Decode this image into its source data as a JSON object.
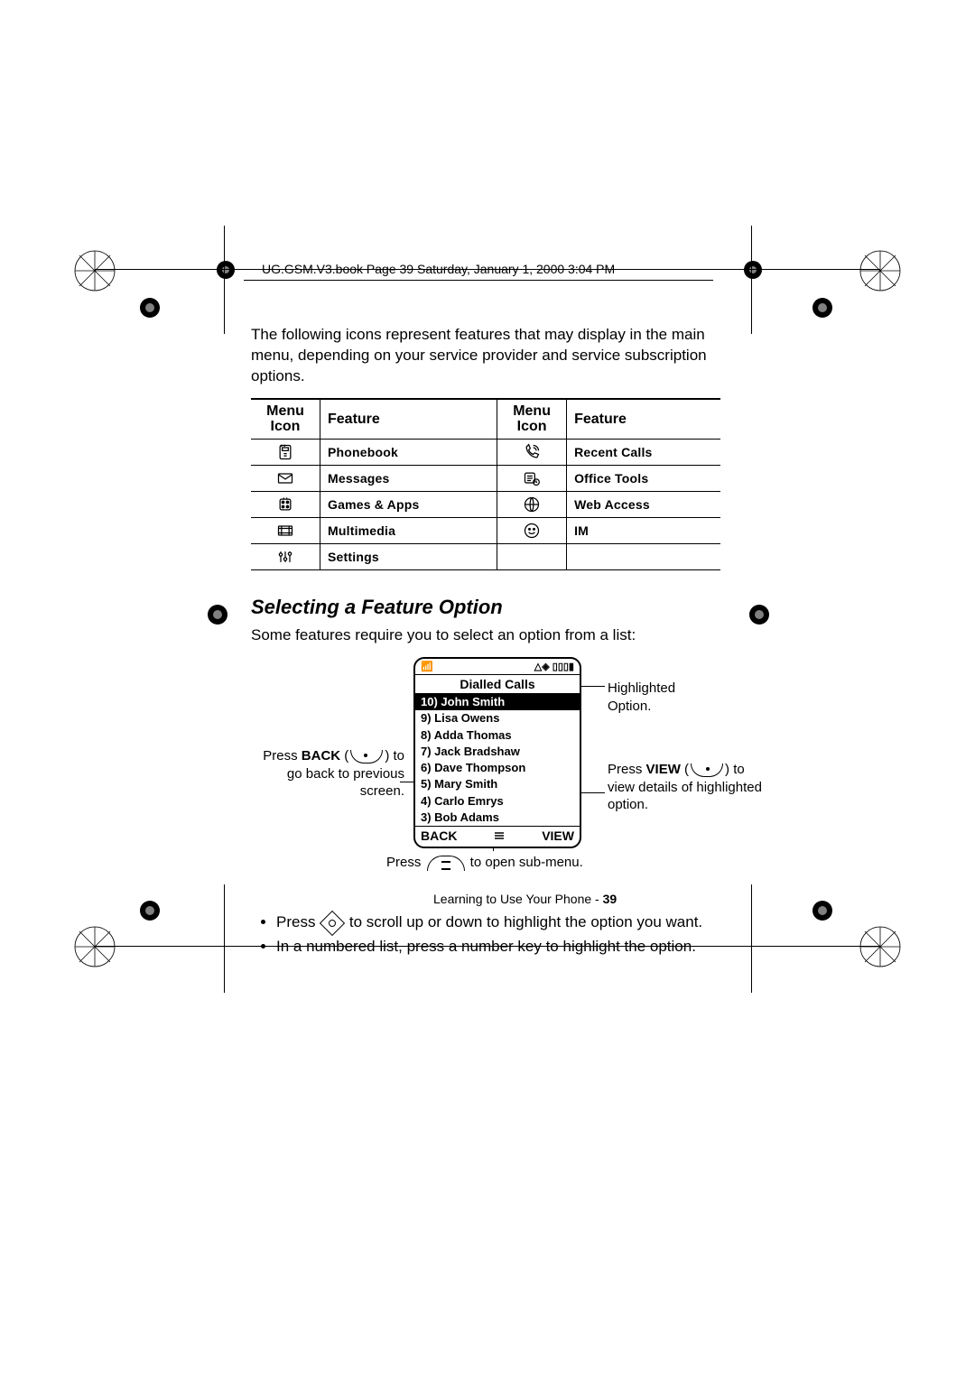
{
  "header": "UG.GSM.V3.book  Page 39  Saturday, January 1, 2000  3:04 PM",
  "intro": "The following icons represent features that may display in the main menu, depending on your service provider and service subscription options.",
  "table": {
    "head": {
      "col1_l1": "Menu",
      "col1_l2": "Icon",
      "col2": "Feature",
      "col3_l1": "Menu",
      "col3_l2": "Icon",
      "col4": "Feature"
    },
    "rows": [
      {
        "left_icon": "phonebook",
        "left": "Phonebook",
        "right_icon": "recent",
        "right": "Recent Calls"
      },
      {
        "left_icon": "messages",
        "left": "Messages",
        "right_icon": "office",
        "right": "Office Tools"
      },
      {
        "left_icon": "games",
        "left": "Games & Apps",
        "right_icon": "web",
        "right": "Web Access"
      },
      {
        "left_icon": "multimedia",
        "left": "Multimedia",
        "right_icon": "im",
        "right": "IM"
      },
      {
        "left_icon": "settings",
        "left": "Settings",
        "right_icon": "",
        "right": ""
      }
    ]
  },
  "section_title": "Selecting a Feature Option",
  "section_intro": "Some features require you to select an option from a list:",
  "phone": {
    "status_left": "▮▯▯▯",
    "status_right": "△◈ ▯▯▯▮",
    "title": "Dialled Calls",
    "items": [
      "10) John Smith",
      "9)  Lisa Owens",
      "8)  Adda Thomas",
      "7)  Jack Bradshaw",
      "6)  Dave Thompson",
      "5)  Mary Smith",
      "4)  Carlo Emrys",
      "3)  Bob Adams"
    ],
    "soft_left": "BACK",
    "soft_right": "VIEW"
  },
  "callouts": {
    "left_pre": "Press ",
    "left_back": "BACK",
    "left_post1": " (",
    "left_post2": ") to go back to previous screen.",
    "right_top": "Highlighted Option.",
    "right_bot_pre": "Press ",
    "right_bot_view": "VIEW",
    "right_bot_post1": " (",
    "right_bot_post2": ") to view details of highlighted option.",
    "bottom_pre": "Press ",
    "bottom_post": " to open sub-menu."
  },
  "bullets": [
    {
      "pre": "Press ",
      "post": " to scroll up or down to highlight the option you want."
    },
    {
      "text": "In a numbered list, press a number key to highlight the option."
    }
  ],
  "footer": {
    "section": "Learning to Use Your Phone - ",
    "page": "39"
  }
}
